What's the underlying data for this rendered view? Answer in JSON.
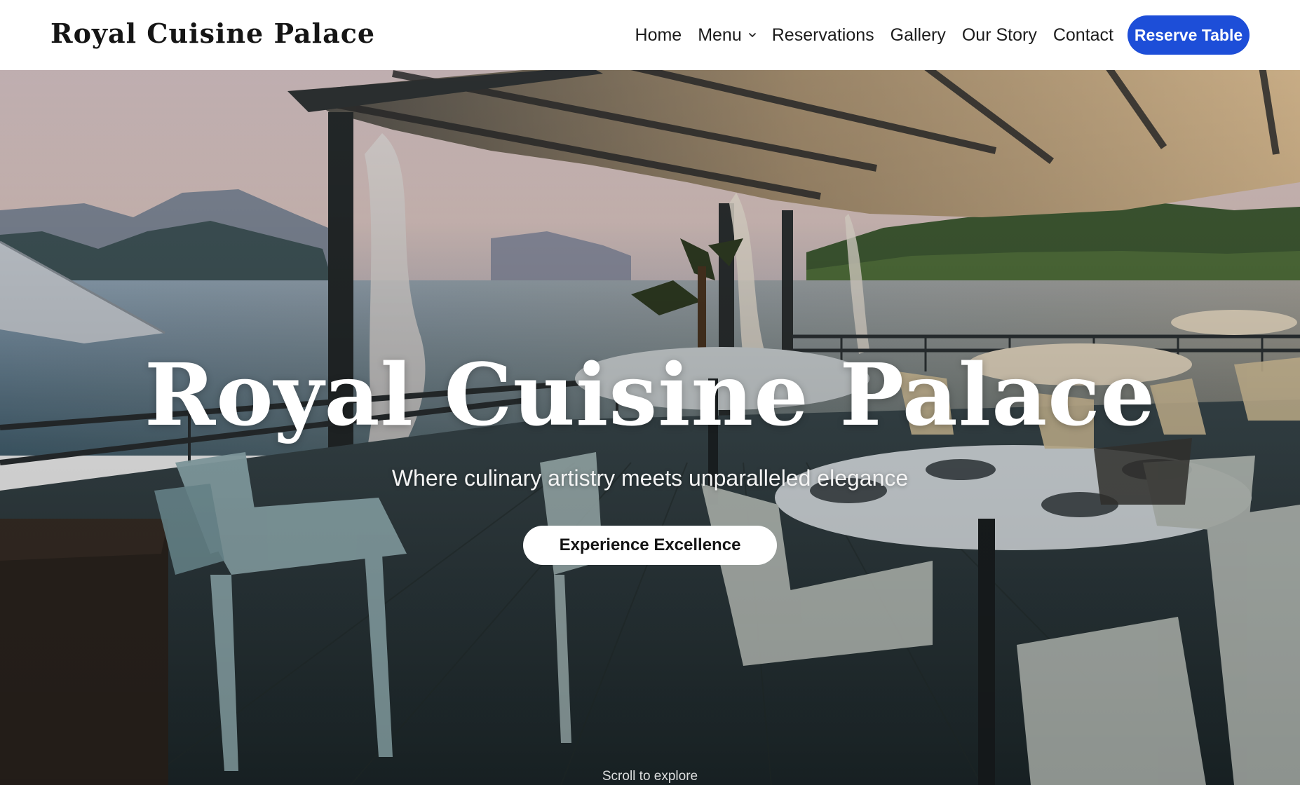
{
  "header": {
    "logo": "Royal Cuisine Palace",
    "nav": [
      {
        "label": "Home"
      },
      {
        "label": "Menu",
        "has_dropdown": true
      },
      {
        "label": "Reservations"
      },
      {
        "label": "Gallery"
      },
      {
        "label": "Our Story"
      },
      {
        "label": "Contact"
      }
    ],
    "cta_label": "Reserve Table"
  },
  "hero": {
    "title": "Royal Cuisine Palace",
    "subtitle": "Where culinary artistry meets unparalleled elegance",
    "cta_label": "Experience Excellence",
    "scroll_hint": "Scroll to explore",
    "image": "lakeside-restaurant-terrace-photo"
  },
  "colors": {
    "accent": "#1d4ed8",
    "header_bg": "#ffffff",
    "text_dark": "#1c1c1c",
    "hero_text": "#ffffff"
  },
  "icons": {
    "dropdown": "chevron-down-icon"
  }
}
